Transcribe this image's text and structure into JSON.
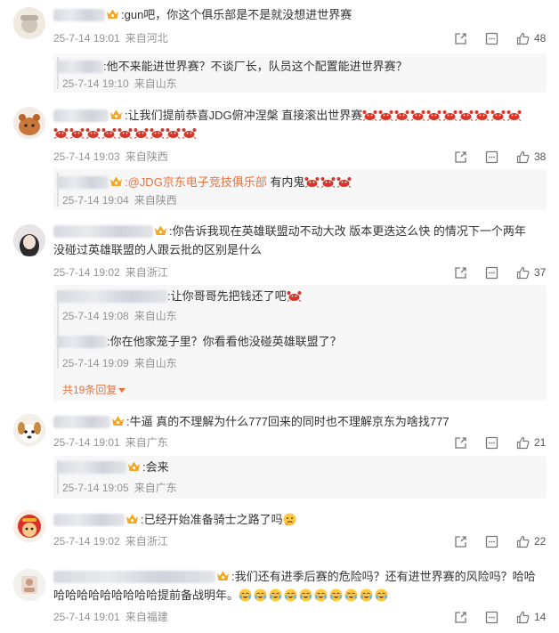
{
  "icons": {
    "share": "share-icon",
    "comment": "comment-icon",
    "like": "thumbs-up-icon",
    "vip": "vip-crown-icon",
    "crab": "crab-emoji-icon",
    "face": "face-emoji-icon"
  },
  "colors": {
    "link": "#eb7340",
    "meta": "#939393",
    "reply_bg": "#f7f7f8"
  },
  "comments": [
    {
      "text": ":gun吧，你这个俱乐部是不是就没想进世界赛",
      "time": "25-7-14 19:01",
      "location": "来自河北",
      "likes": "48",
      "replies": [
        {
          "text": ":他不来能进世界赛？不谈厂长，队员这个配置能进世界赛？",
          "time": "25-7-14 19:10",
          "location": "来自山东"
        }
      ]
    },
    {
      "text": ":让我们提前恭喜JDG俯冲涅槃 直接滚出世界赛",
      "time": "25-7-14 19:03",
      "location": "来自陕西",
      "likes": "38",
      "replies": [
        {
          "mention": ":@JDG京东电子竞技俱乐部",
          "text": " 有内鬼",
          "time": "25-7-14 19:04",
          "location": "来自陕西"
        }
      ]
    },
    {
      "text": ":你告诉我现在英雄联盟动不动大改 版本更迭这么快 的情况下一个两年",
      "text2": "没碰过英雄联盟的人跟云批的区别是什么",
      "time": "25-7-14 19:02",
      "location": "来自浙江",
      "likes": "37",
      "replies": [
        {
          "text": ":让你哥哥先把钱还了吧",
          "time": "25-7-14 19:08",
          "location": "来自山东"
        },
        {
          "text": ":你在他家笼子里？你看看他没碰英雄联盟了？",
          "time": "25-7-14 19:09",
          "location": "来自山东"
        }
      ],
      "more_replies": "共19条回复"
    },
    {
      "text": ":牛逼 真的不理解为什么777回来的同时也不理解京东为啥找777",
      "time": "25-7-14 19:01",
      "location": "来自广东",
      "likes": "21",
      "replies": [
        {
          "text": ":会来",
          "time": "25-7-14 19:05",
          "location": "来自广东"
        }
      ]
    },
    {
      "text": ":已经开始准备骑士之路了吗",
      "time": "25-7-14 19:02",
      "location": "来自浙江",
      "likes": "22",
      "replies": []
    },
    {
      "text": ":我们还有进季后赛的危险吗？还有进世界赛的风险吗？哈哈",
      "text2": "哈哈哈哈哈哈哈哈哈提前备战明年。",
      "time": "25-7-14 19:01",
      "location": "来自福建",
      "likes": "14",
      "replies": []
    }
  ]
}
